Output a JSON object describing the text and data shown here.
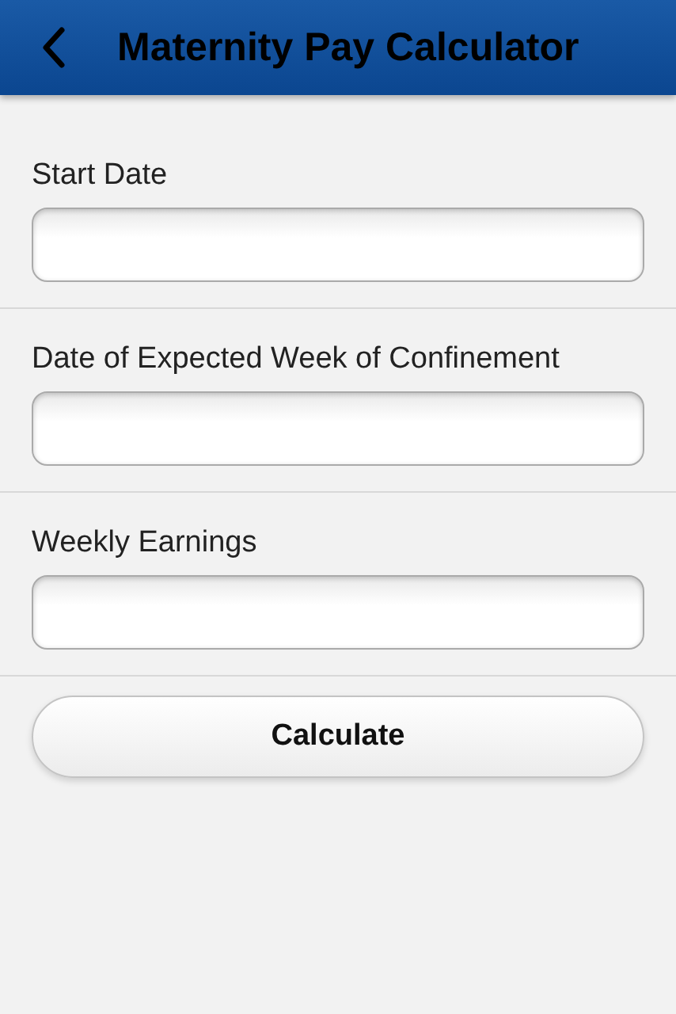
{
  "header": {
    "title": "Maternity Pay Calculator"
  },
  "fields": [
    {
      "label": "Start Date"
    },
    {
      "label": "Date of Expected Week of Confinement"
    },
    {
      "label": "Weekly Earnings"
    }
  ],
  "button": {
    "label": "Calculate"
  }
}
